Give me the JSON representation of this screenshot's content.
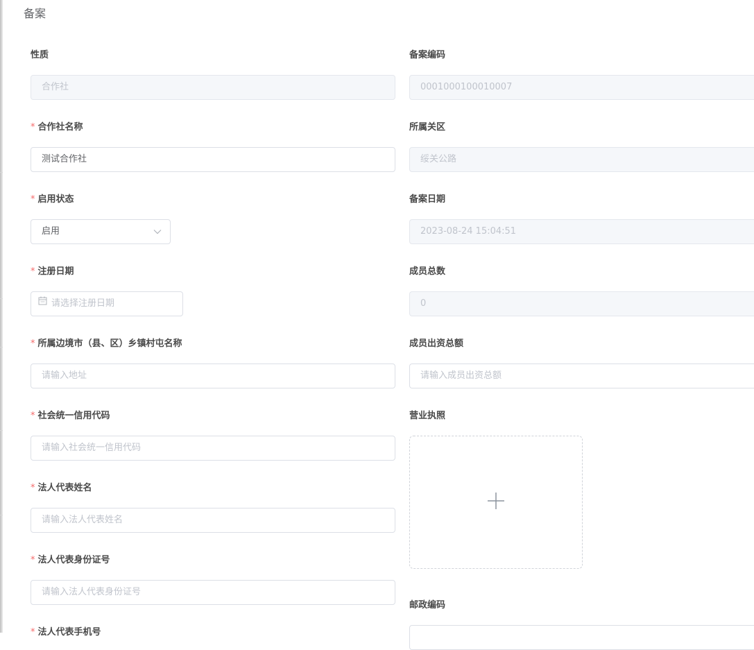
{
  "dialog": {
    "title": "备案"
  },
  "form": {
    "nature": {
      "label": "性质",
      "value": "合作社"
    },
    "filing_code": {
      "label": "备案编码",
      "value": "0001000100010007"
    },
    "coop_name": {
      "label": "合作社名称",
      "value": "测试合作社",
      "required": "*"
    },
    "customs_district": {
      "label": "所属关区",
      "value": "绥关公路"
    },
    "status": {
      "label": "启用状态",
      "value": "启用",
      "required": "*"
    },
    "filing_date": {
      "label": "备案日期",
      "value": "2023-08-24 15:04:51"
    },
    "registration_date": {
      "label": "注册日期",
      "placeholder": "请选择注册日期",
      "required": "*"
    },
    "member_count": {
      "label": "成员总数",
      "value": "0"
    },
    "address": {
      "label": "所属边境市（县、区）乡镇村屯名称",
      "placeholder": "请输入地址",
      "required": "*"
    },
    "member_capital": {
      "label": "成员出资总额",
      "placeholder": "请输入成员出资总额"
    },
    "credit_code": {
      "label": "社会统一信用代码",
      "placeholder": "请输入社会统一信用代码",
      "required": "*"
    },
    "business_license": {
      "label": "营业执照"
    },
    "legal_rep_name": {
      "label": "法人代表姓名",
      "placeholder": "请输入法人代表姓名",
      "required": "*"
    },
    "legal_rep_id": {
      "label": "法人代表身份证号",
      "placeholder": "请输入法人代表身份证号",
      "required": "*"
    },
    "postal_code": {
      "label": "邮政编码"
    },
    "legal_rep_phone": {
      "label": "法人代表手机号",
      "required": "*"
    }
  },
  "icons": {
    "select_arrow": "chevron-down-icon",
    "date": "calendar-icon",
    "upload": "plus-icon"
  },
  "colors": {
    "required": "#f56c6c",
    "border": "#dcdfe6",
    "disabled_bg": "#f5f7fa",
    "placeholder": "#c0c4cc",
    "text": "#606266"
  }
}
